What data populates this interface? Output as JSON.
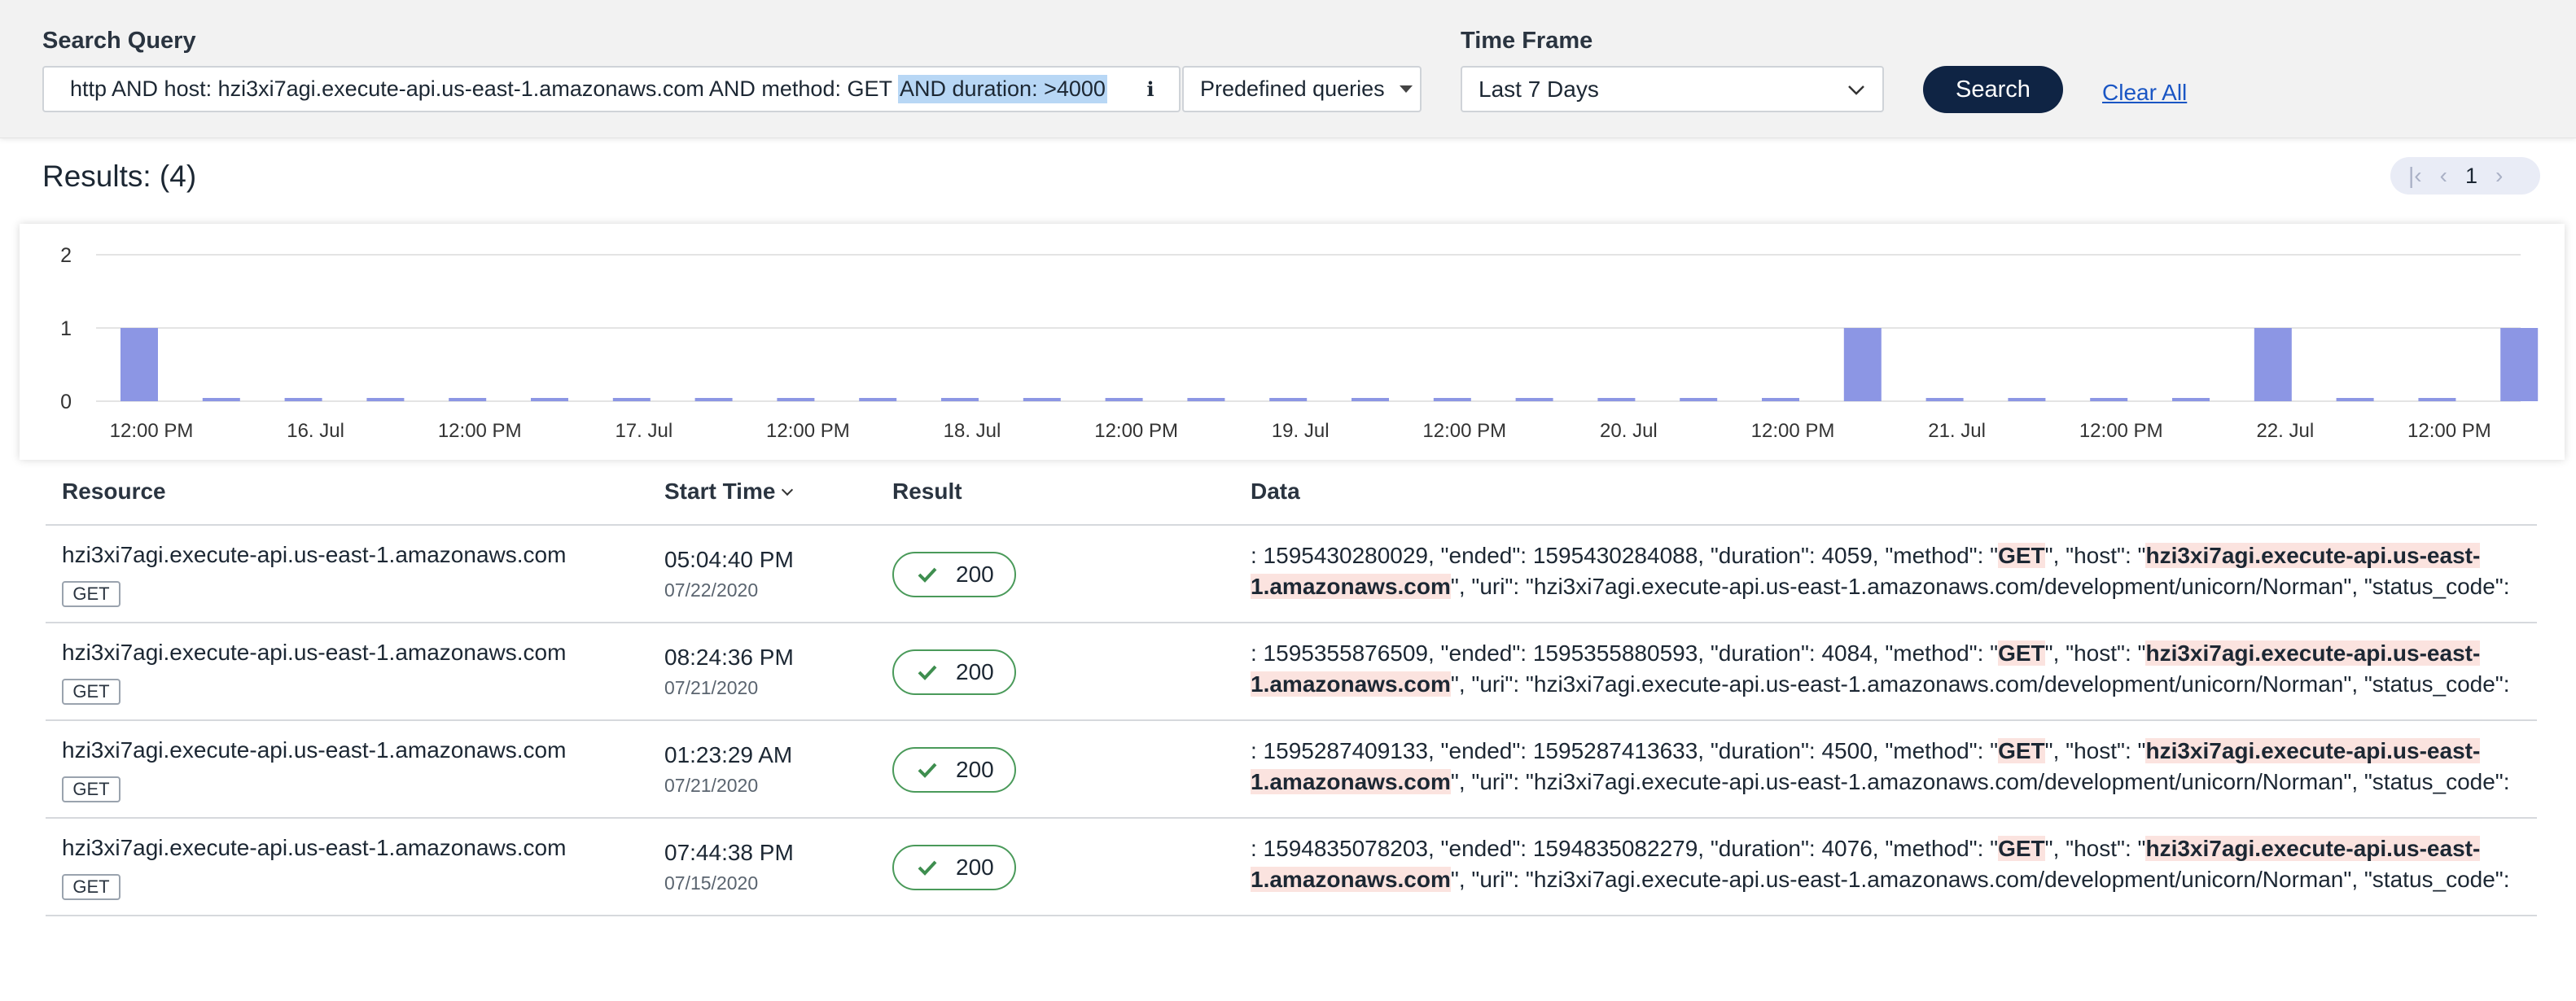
{
  "search": {
    "label": "Search Query",
    "query_main": "http AND host: hzi3xi7agi.execute-api.us-east-1.amazonaws.com AND method: GET ",
    "query_highlight": "AND duration: >4000",
    "info_icon": "info-icon",
    "predefined_label": "Predefined queries",
    "time_label": "Time Frame",
    "time_value": "Last 7 Days",
    "search_button": "Search",
    "clear_all": "Clear All"
  },
  "results": {
    "title": "Results: (4)",
    "page": "1"
  },
  "chart_data": {
    "type": "bar",
    "ylim": [
      0,
      2
    ],
    "yticks": [
      "0",
      "1",
      "2"
    ],
    "xtick_labels": [
      "12:00 PM",
      "16. Jul",
      "12:00 PM",
      "17. Jul",
      "12:00 PM",
      "18. Jul",
      "12:00 PM",
      "19. Jul",
      "12:00 PM",
      "20. Jul",
      "12:00 PM",
      "21. Jul",
      "12:00 PM",
      "22. Jul",
      "12:00 PM"
    ],
    "values": [
      1,
      0,
      0,
      0,
      0,
      0,
      0,
      0,
      0,
      0,
      0,
      0,
      0,
      0,
      0,
      0,
      0,
      0,
      0,
      0,
      0,
      1,
      0,
      0,
      0,
      0,
      1,
      0,
      0,
      1
    ],
    "grid": true,
    "color": "#8c96e4"
  },
  "table": {
    "columns": [
      "Resource",
      "Start Time",
      "Result",
      "Data"
    ],
    "rows": [
      {
        "resource": "hzi3xi7agi.execute-api.us-east-1.amazonaws.com",
        "method": "GET",
        "time": "05:04:40 PM",
        "date": "07/22/2020",
        "status": "200",
        "line1_a": ": 1595430280029, \"ended\": 1595430284088, \"duration\": 4059, \"method\": \"",
        "line1_m1": "GET",
        "line1_b": "\", \"host\": \"",
        "line1_m2": "hzi3xi7agi.execute-api.us-east-",
        "line2_m": "1.amazonaws.com",
        "line2_b": "\", \"uri\": \"hzi3xi7agi.execute-api.us-east-1.amazonaws.com/development/unicorn/Norman\", \"status_code\":"
      },
      {
        "resource": "hzi3xi7agi.execute-api.us-east-1.amazonaws.com",
        "method": "GET",
        "time": "08:24:36 PM",
        "date": "07/21/2020",
        "status": "200",
        "line1_a": ": 1595355876509, \"ended\": 1595355880593, \"duration\": 4084, \"method\": \"",
        "line1_m1": "GET",
        "line1_b": "\", \"host\": \"",
        "line1_m2": "hzi3xi7agi.execute-api.us-east-",
        "line2_m": "1.amazonaws.com",
        "line2_b": "\", \"uri\": \"hzi3xi7agi.execute-api.us-east-1.amazonaws.com/development/unicorn/Norman\", \"status_code\":"
      },
      {
        "resource": "hzi3xi7agi.execute-api.us-east-1.amazonaws.com",
        "method": "GET",
        "time": "01:23:29 AM",
        "date": "07/21/2020",
        "status": "200",
        "line1_a": ": 1595287409133, \"ended\": 1595287413633, \"duration\": 4500, \"method\": \"",
        "line1_m1": "GET",
        "line1_b": "\", \"host\": \"",
        "line1_m2": "hzi3xi7agi.execute-api.us-east-",
        "line2_m": "1.amazonaws.com",
        "line2_b": "\", \"uri\": \"hzi3xi7agi.execute-api.us-east-1.amazonaws.com/development/unicorn/Norman\", \"status_code\":"
      },
      {
        "resource": "hzi3xi7agi.execute-api.us-east-1.amazonaws.com",
        "method": "GET",
        "time": "07:44:38 PM",
        "date": "07/15/2020",
        "status": "200",
        "line1_a": ": 1594835078203, \"ended\": 1594835082279, \"duration\": 4076, \"method\": \"",
        "line1_m1": "GET",
        "line1_b": "\", \"host\": \"",
        "line1_m2": "hzi3xi7agi.execute-api.us-east-",
        "line2_m": "1.amazonaws.com",
        "line2_b": "\", \"uri\": \"hzi3xi7agi.execute-api.us-east-1.amazonaws.com/development/unicorn/Norman\", \"status_code\":"
      }
    ]
  }
}
